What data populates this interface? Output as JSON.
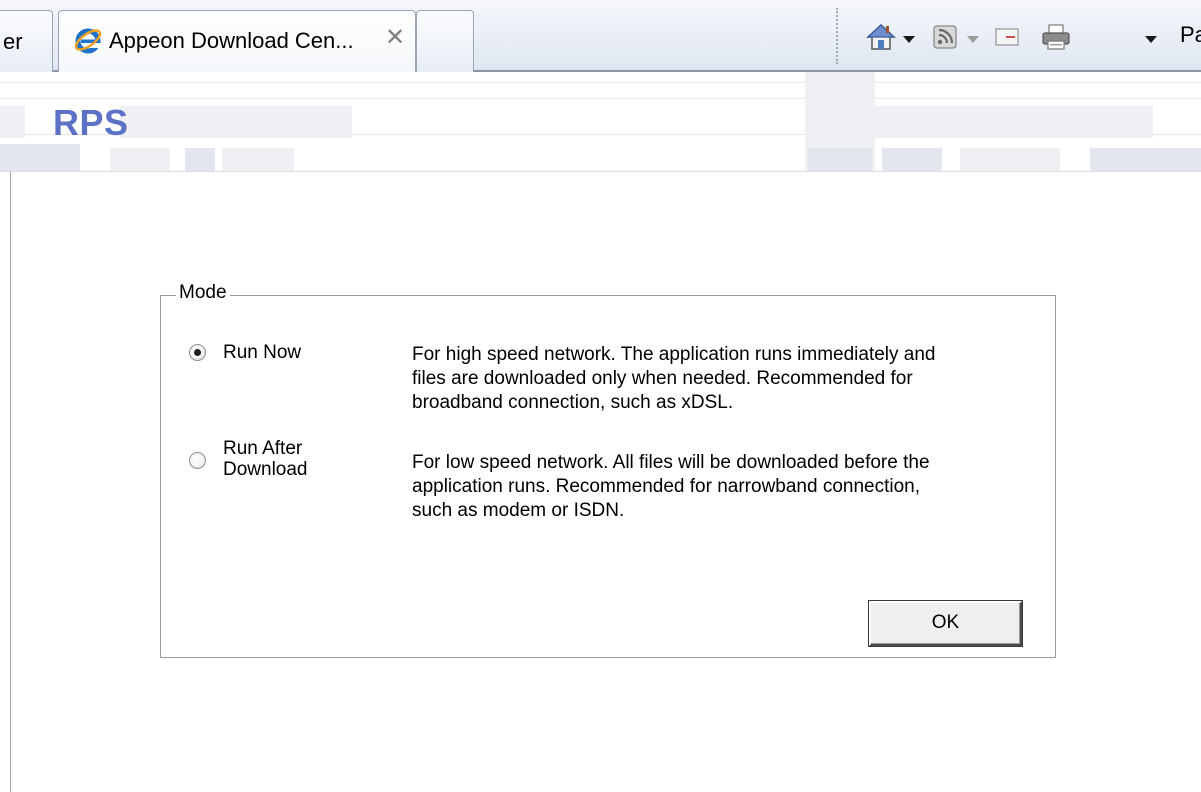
{
  "browser": {
    "tabs": [
      {
        "label": "er",
        "active": false
      },
      {
        "label": "Appeon Download Cen...",
        "active": true,
        "icon": "ie-icon"
      }
    ],
    "close_glyph": "✕",
    "commands": {
      "page_label": "Pa"
    },
    "icons": [
      "ie-icon",
      "home-icon",
      "rss-feed-icon",
      "read-mail-icon",
      "print-icon",
      "close-icon"
    ]
  },
  "banner": {
    "title": "RPS"
  },
  "mode": {
    "legend": "Mode",
    "options": [
      {
        "label_lines": [
          "Run Now"
        ],
        "selected": true,
        "description_lines": [
          "For high speed network. The application runs immediately and",
          "files are downloaded only when needed. Recommended for",
          "broadband connection, such as xDSL."
        ]
      },
      {
        "label_lines": [
          "Run After",
          "Download"
        ],
        "selected": false,
        "description_lines": [
          "For low speed network. All files will be downloaded before the",
          "application runs. Recommended for narrowband connection,",
          "such as modem or ISDN."
        ]
      }
    ],
    "ok_label": "OK"
  },
  "colors": {
    "title_blue": "#5d72c6",
    "tab_border": "#9aa6b8",
    "fieldset_border": "#9a9a9a"
  }
}
